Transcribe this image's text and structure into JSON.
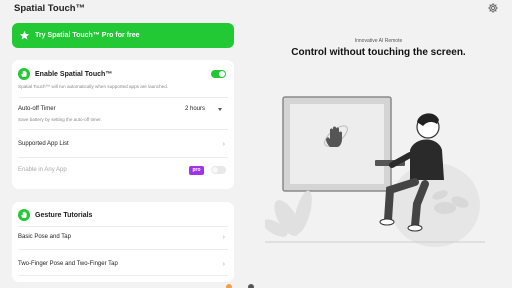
{
  "app": {
    "title": "Spatial Touch™"
  },
  "promo": {
    "label": "Try Spatial Touch™ Pro for free"
  },
  "enable_section": {
    "title": "Enable Spatial Touch™",
    "description": "Spatial Touch™ will run automatically when supported apps are launched.",
    "enabled": true,
    "auto_off": {
      "label": "Auto-off Timer",
      "value": "2 hours",
      "description": "Save battery by setting the auto-off timer."
    },
    "supported_apps": {
      "label": "Supported App List"
    },
    "enable_any_app": {
      "label": "Enable in Any App",
      "badge": "pro",
      "enabled": false
    }
  },
  "gestures": {
    "title": "Gesture Tutorials",
    "items": [
      {
        "label": "Basic Pose and Tap"
      },
      {
        "label": "Two-Finger Pose and Two-Finger Tap"
      }
    ]
  },
  "hero": {
    "subtitle": "Innovative AI Remote",
    "title": "Control without touching the screen."
  },
  "colors": {
    "accent": "#22c934",
    "pro": "#a032e8",
    "background": "#f2f2f2"
  },
  "icons": {
    "settings": "gear-icon",
    "promo": "star-icon",
    "enable": "hand-icon",
    "gestures": "hand-icon",
    "rows": "chevron-right-icon"
  }
}
